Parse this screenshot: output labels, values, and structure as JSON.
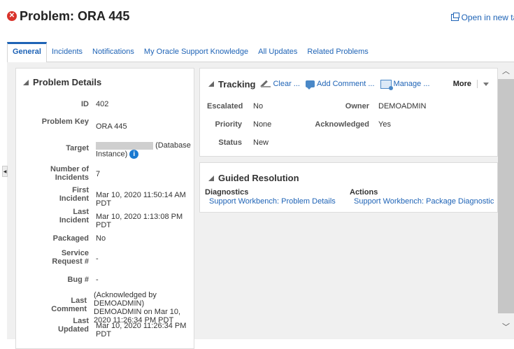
{
  "header": {
    "title": "Problem: ORA 445",
    "open_new_tab": "Open in new tab"
  },
  "tabs": [
    "General",
    "Incidents",
    "Notifications",
    "My Oracle Support Knowledge",
    "All Updates",
    "Related Problems"
  ],
  "problem_details": {
    "title": "Problem Details",
    "rows": [
      {
        "label": "ID",
        "value": "402"
      },
      {
        "label": "Problem Key",
        "value": "ORA 445"
      },
      {
        "label": "Target",
        "value": "(Database Instance)"
      },
      {
        "label": "Number of Incidents",
        "value": "7"
      },
      {
        "label": "First Incident",
        "value": "Mar 10, 2020 11:50:14 AM PDT"
      },
      {
        "label": "Last Incident",
        "value": "Mar 10, 2020 1:13:08 PM PDT"
      },
      {
        "label": "Packaged",
        "value": "No"
      },
      {
        "label": "Service Request #",
        "value": "-"
      },
      {
        "label": "Bug #",
        "value": "-"
      },
      {
        "label": "Last Comment",
        "value": "(Acknowledged by DEMOADMIN) DEMOADMIN on Mar 10, 2020 11:26:34 PM PDT"
      },
      {
        "label": "Last Updated",
        "value": "Mar 10, 2020 11:26:34 PM PDT"
      }
    ]
  },
  "tracking": {
    "title": "Tracking",
    "clear": "Clear ...",
    "add_comment": "Add Comment ...",
    "manage": "Manage ...",
    "more": "More",
    "escalated_label": "Escalated",
    "escalated_value": "No",
    "priority_label": "Priority",
    "priority_value": "None",
    "status_label": "Status",
    "status_value": "New",
    "owner_label": "Owner",
    "owner_value": "DEMOADMIN",
    "ack_label": "Acknowledged",
    "ack_value": "Yes"
  },
  "guided": {
    "title": "Guided Resolution",
    "diagnostics_label": "Diagnostics",
    "diagnostics_link": "Support Workbench: Problem Details",
    "actions_label": "Actions",
    "actions_link": "Support Workbench: Package Diagnostic"
  },
  "icons": {
    "error": "error-icon",
    "info": "info-icon"
  }
}
